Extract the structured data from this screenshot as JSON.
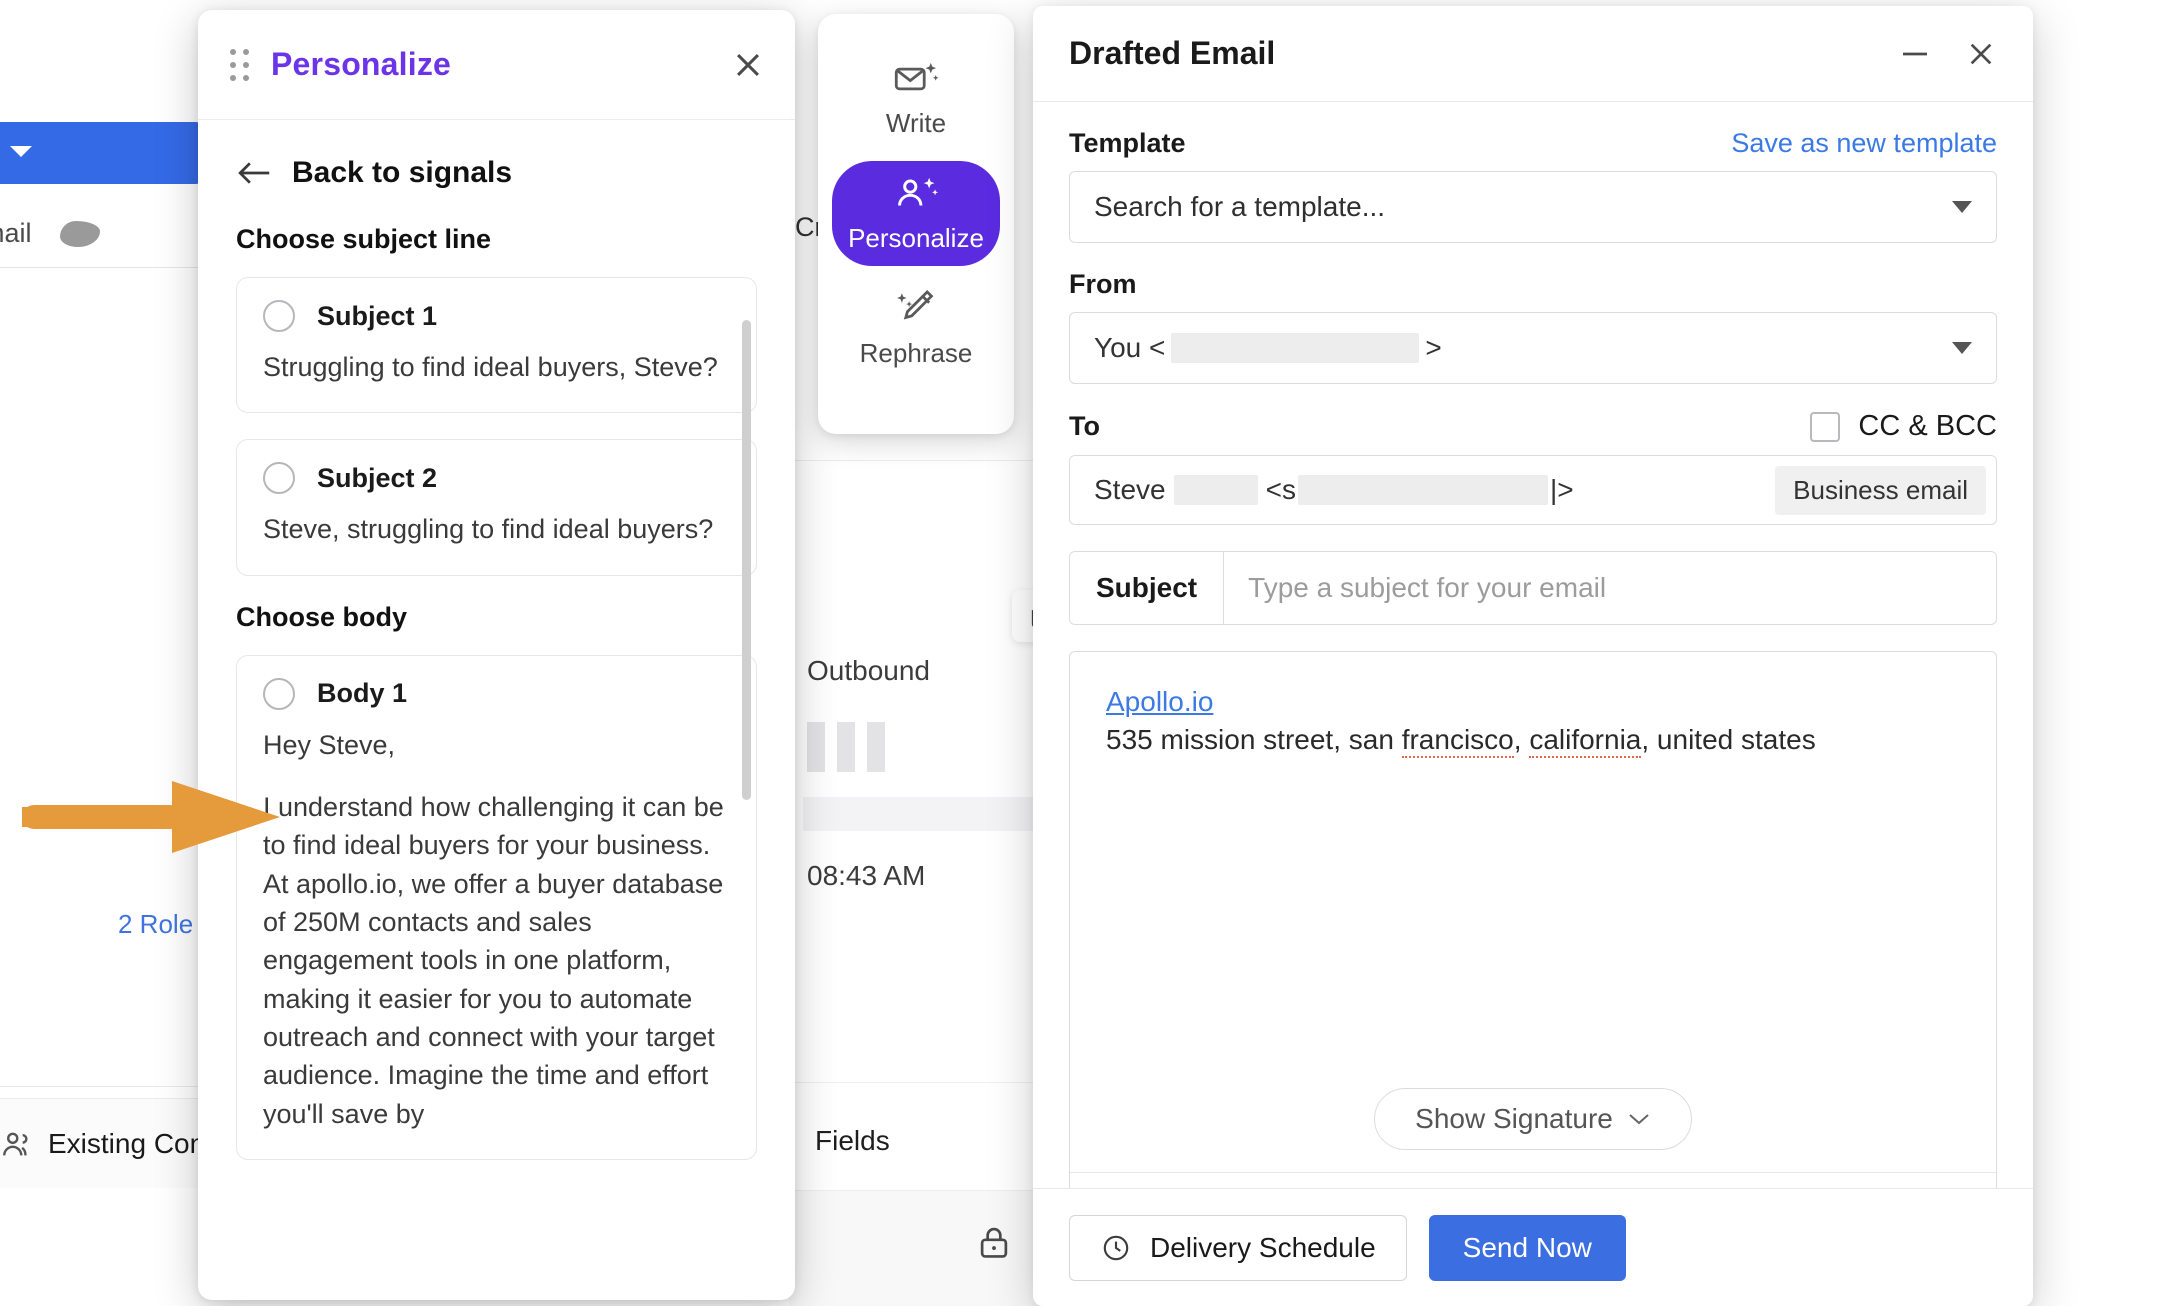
{
  "background": {
    "mail_label": "mail",
    "roles_link": "2 Role",
    "existing_contacts": "Existing Con",
    "cr_text": "Cr",
    "outbound_label": "Outbound",
    "time_label": "08:43 AM",
    "fields_label": "Fields",
    "icons": {
      "people": "people-icon",
      "copy": "copy-icon",
      "lock": "lock-icon",
      "caret": "caret-down-icon",
      "blob": "redacted-blob"
    }
  },
  "personalize_panel": {
    "title": "Personalize",
    "drag_handle": "drag-handle-icon",
    "close_icon": "close-icon",
    "back_label": "Back to signals",
    "back_icon": "arrow-left-icon",
    "subject_section_label": "Choose subject line",
    "body_section_label": "Choose body",
    "subjects": [
      {
        "title": "Subject 1",
        "text": "Struggling to find ideal buyers, Steve?"
      },
      {
        "title": "Subject 2",
        "text": "Steve, struggling to find ideal buyers?"
      }
    ],
    "bodies": [
      {
        "title": "Body 1",
        "greeting": "Hey Steve,",
        "paragraph": "I understand how challenging it can be to find ideal buyers for your business. At apollo.io, we offer a buyer database of 250M contacts and sales engagement tools in one platform, making it easier for you to automate outreach and connect with your target audience. Imagine the time and effort you'll save by"
      }
    ]
  },
  "ai_toolbar": {
    "items": [
      {
        "label": "Write",
        "icon": "mail-sparkle-icon",
        "active": false
      },
      {
        "label": "Personalize",
        "icon": "person-sparkle-icon",
        "active": true
      },
      {
        "label": "Rephrase",
        "icon": "pencil-sparkle-icon",
        "active": false
      }
    ],
    "active_color": "#5b2be0"
  },
  "drafted_email": {
    "title": "Drafted Email",
    "minimize_icon": "minimize-icon",
    "close_icon": "close-icon",
    "template_label": "Template",
    "save_template_link": "Save as new template",
    "template_placeholder": "Search for a template...",
    "from_label": "From",
    "from_value_prefix": "You <",
    "from_value_suffix": ">",
    "to_label": "To",
    "cc_bcc_label": "CC & BCC",
    "to_name": "Steve",
    "to_email_open": "<s",
    "to_email_close": "|>",
    "to_badge": "Business email",
    "subject_label": "Subject",
    "subject_placeholder": "Type a subject for your email",
    "signature_link": "Apollo.io",
    "signature_address_part1": "535 mission street, san ",
    "signature_address_spell1": "francisco",
    "signature_address_part2": ", ",
    "signature_address_spell2": "california",
    "signature_address_part3": ", united states",
    "show_signature_label": "Show Signature",
    "chevron_icon": "chevron-down-icon",
    "toolbar_icons": [
      "text-format-icon",
      "link-icon",
      "image-icon",
      "attachment-icon",
      "code-icon",
      "apollo-bug-icon",
      "exclamation-circle-icon",
      "scissors-icon",
      "calendar-icon"
    ],
    "delivery_schedule_label": "Delivery Schedule",
    "delivery_icon": "clock-icon",
    "send_now_label": "Send Now",
    "accent_blue": "#3b6ee0",
    "link_blue": "#3b7ae4"
  },
  "annotation": {
    "arrow": "orange-pointer-arrow",
    "arrow_color": "#e59b3c"
  }
}
